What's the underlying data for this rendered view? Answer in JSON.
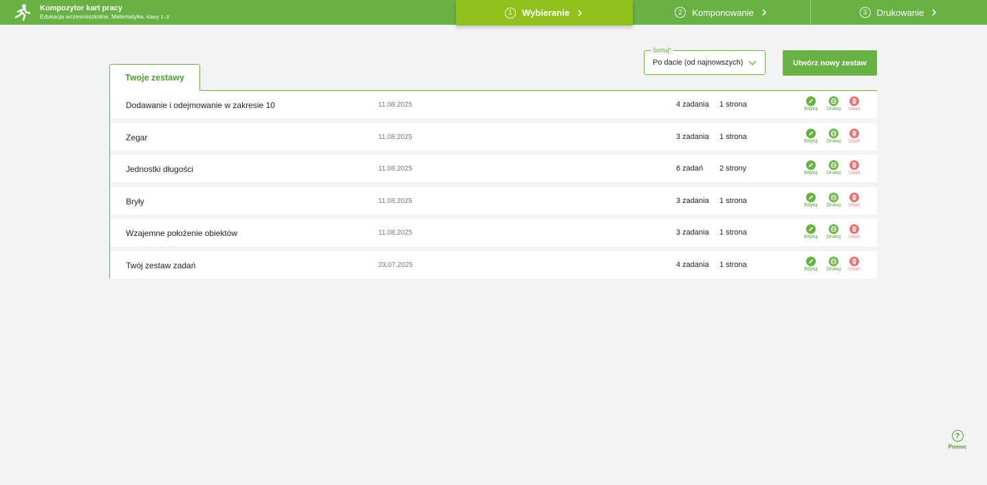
{
  "header": {
    "title": "Kompozytor kart pracy",
    "subtitle": "Edukacja wczesnoszkolna. Matematyka.",
    "subtitle_small": "Klasy 1–3",
    "steps": [
      {
        "num": "1",
        "label": "Wybieranie"
      },
      {
        "num": "2",
        "label": "Komponowanie"
      },
      {
        "num": "3",
        "label": "Drukowanie"
      }
    ]
  },
  "sort": {
    "label": "Sortuj*",
    "value": "Po dacie (od najnowszych)"
  },
  "new_set_button": "Utwórz nowy zestaw",
  "tab_label": "Twoje zestawy",
  "actions": {
    "edit": "Edytuj",
    "print": "Drukuj",
    "delete": "Usuń"
  },
  "rows": [
    {
      "name": "Dodawanie i odejmowanie w zakresie 10",
      "date": "11.08.2025",
      "tasks": "4 zadania",
      "pages": "1 strona"
    },
    {
      "name": "Zegar",
      "date": "11.08.2025",
      "tasks": "3 zadania",
      "pages": "1 strona"
    },
    {
      "name": "Jednostki długości",
      "date": "11.08.2025",
      "tasks": "6 zadań",
      "pages": "2 strony"
    },
    {
      "name": "Bryły",
      "date": "11.08.2025",
      "tasks": "3 zadania",
      "pages": "1 strona"
    },
    {
      "name": "Wzajemne położenie obiektów",
      "date": "11.08.2025",
      "tasks": "3 zadania",
      "pages": "1 strona"
    },
    {
      "name": "Twój zestaw zadań",
      "date": "23.07.2025",
      "tasks": "4 zadania",
      "pages": "1 strona"
    }
  ],
  "help_label": "Pomoc",
  "colors": {
    "brand_green": "#68b144",
    "active_step": "#8fc21c",
    "delete_red": "#e57373"
  }
}
